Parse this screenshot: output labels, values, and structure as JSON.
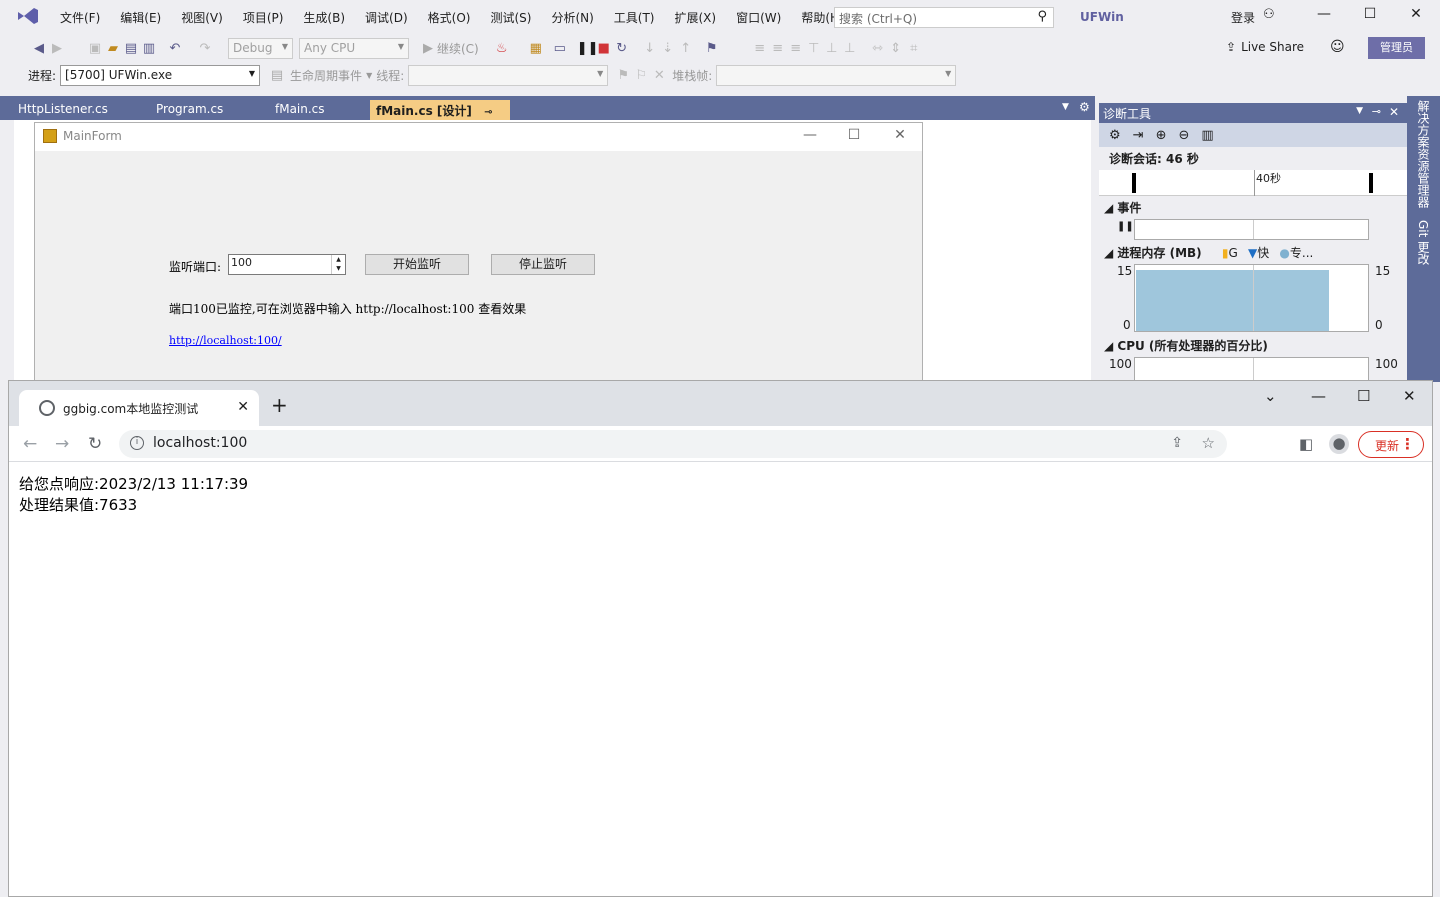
{
  "menu": [
    "文件(F)",
    "编辑(E)",
    "视图(V)",
    "项目(P)",
    "生成(B)",
    "调试(D)",
    "格式(O)",
    "测试(S)",
    "分析(N)",
    "工具(T)",
    "扩展(X)",
    "窗口(W)",
    "帮助(H)"
  ],
  "search_placeholder": "搜索 (Ctrl+Q)",
  "solution_title": "UFWin",
  "login_label": "登录",
  "toolbar": {
    "config": "Debug",
    "platform": "Any CPU",
    "continue_label": "继续(C)",
    "live_share": "Live Share",
    "admin": "管理员"
  },
  "toolbar2": {
    "process_label": "进程:",
    "process_value": "[5700] UFWin.exe",
    "lifecycle_label": "生命周期事件",
    "thread_label": "线程:",
    "stack_label": "堆栈帧:"
  },
  "tabs": [
    "HttpListener.cs",
    "Program.cs",
    "fMain.cs",
    "fMain.cs [设计]"
  ],
  "form": {
    "title": "MainForm",
    "port_label": "监听端口:",
    "port_value": "100",
    "start_button": "开始监听",
    "stop_button": "停止监听",
    "status_text": "端口100已监控,可在浏览器中输入 http://localhost:100 查看效果",
    "link": "http://localhost:100/"
  },
  "diagnostics": {
    "title": "诊断工具",
    "session": "诊断会话: 46 秒",
    "tick_label": "40秒",
    "events_label": "事件",
    "memory_label": "进程内存 (MB)",
    "legend": [
      "G",
      "快",
      "专..."
    ],
    "memory_max": "15",
    "memory_min": "0",
    "memory_level": 0.92,
    "cpu_label": "CPU (所有处理器的百分比)",
    "cpu_max": "100"
  },
  "sidebar": {
    "solution_explorer": "解决方案资源管理器",
    "git": "Git 更改"
  },
  "browser": {
    "tab_title": "ggbig.com本地监控测试",
    "url": "localhost:100",
    "update_label": "更新",
    "lines": [
      "给您点响应:2023/2/13 11:17:39",
      "处理结果值:7633"
    ]
  },
  "colors": {
    "vs_chrome": "#eeeef2",
    "tab_strip": "#5d6b99",
    "active_tab": "#f5cc84",
    "memory_fill": "#9fc6dc",
    "update_red": "#d93025"
  }
}
